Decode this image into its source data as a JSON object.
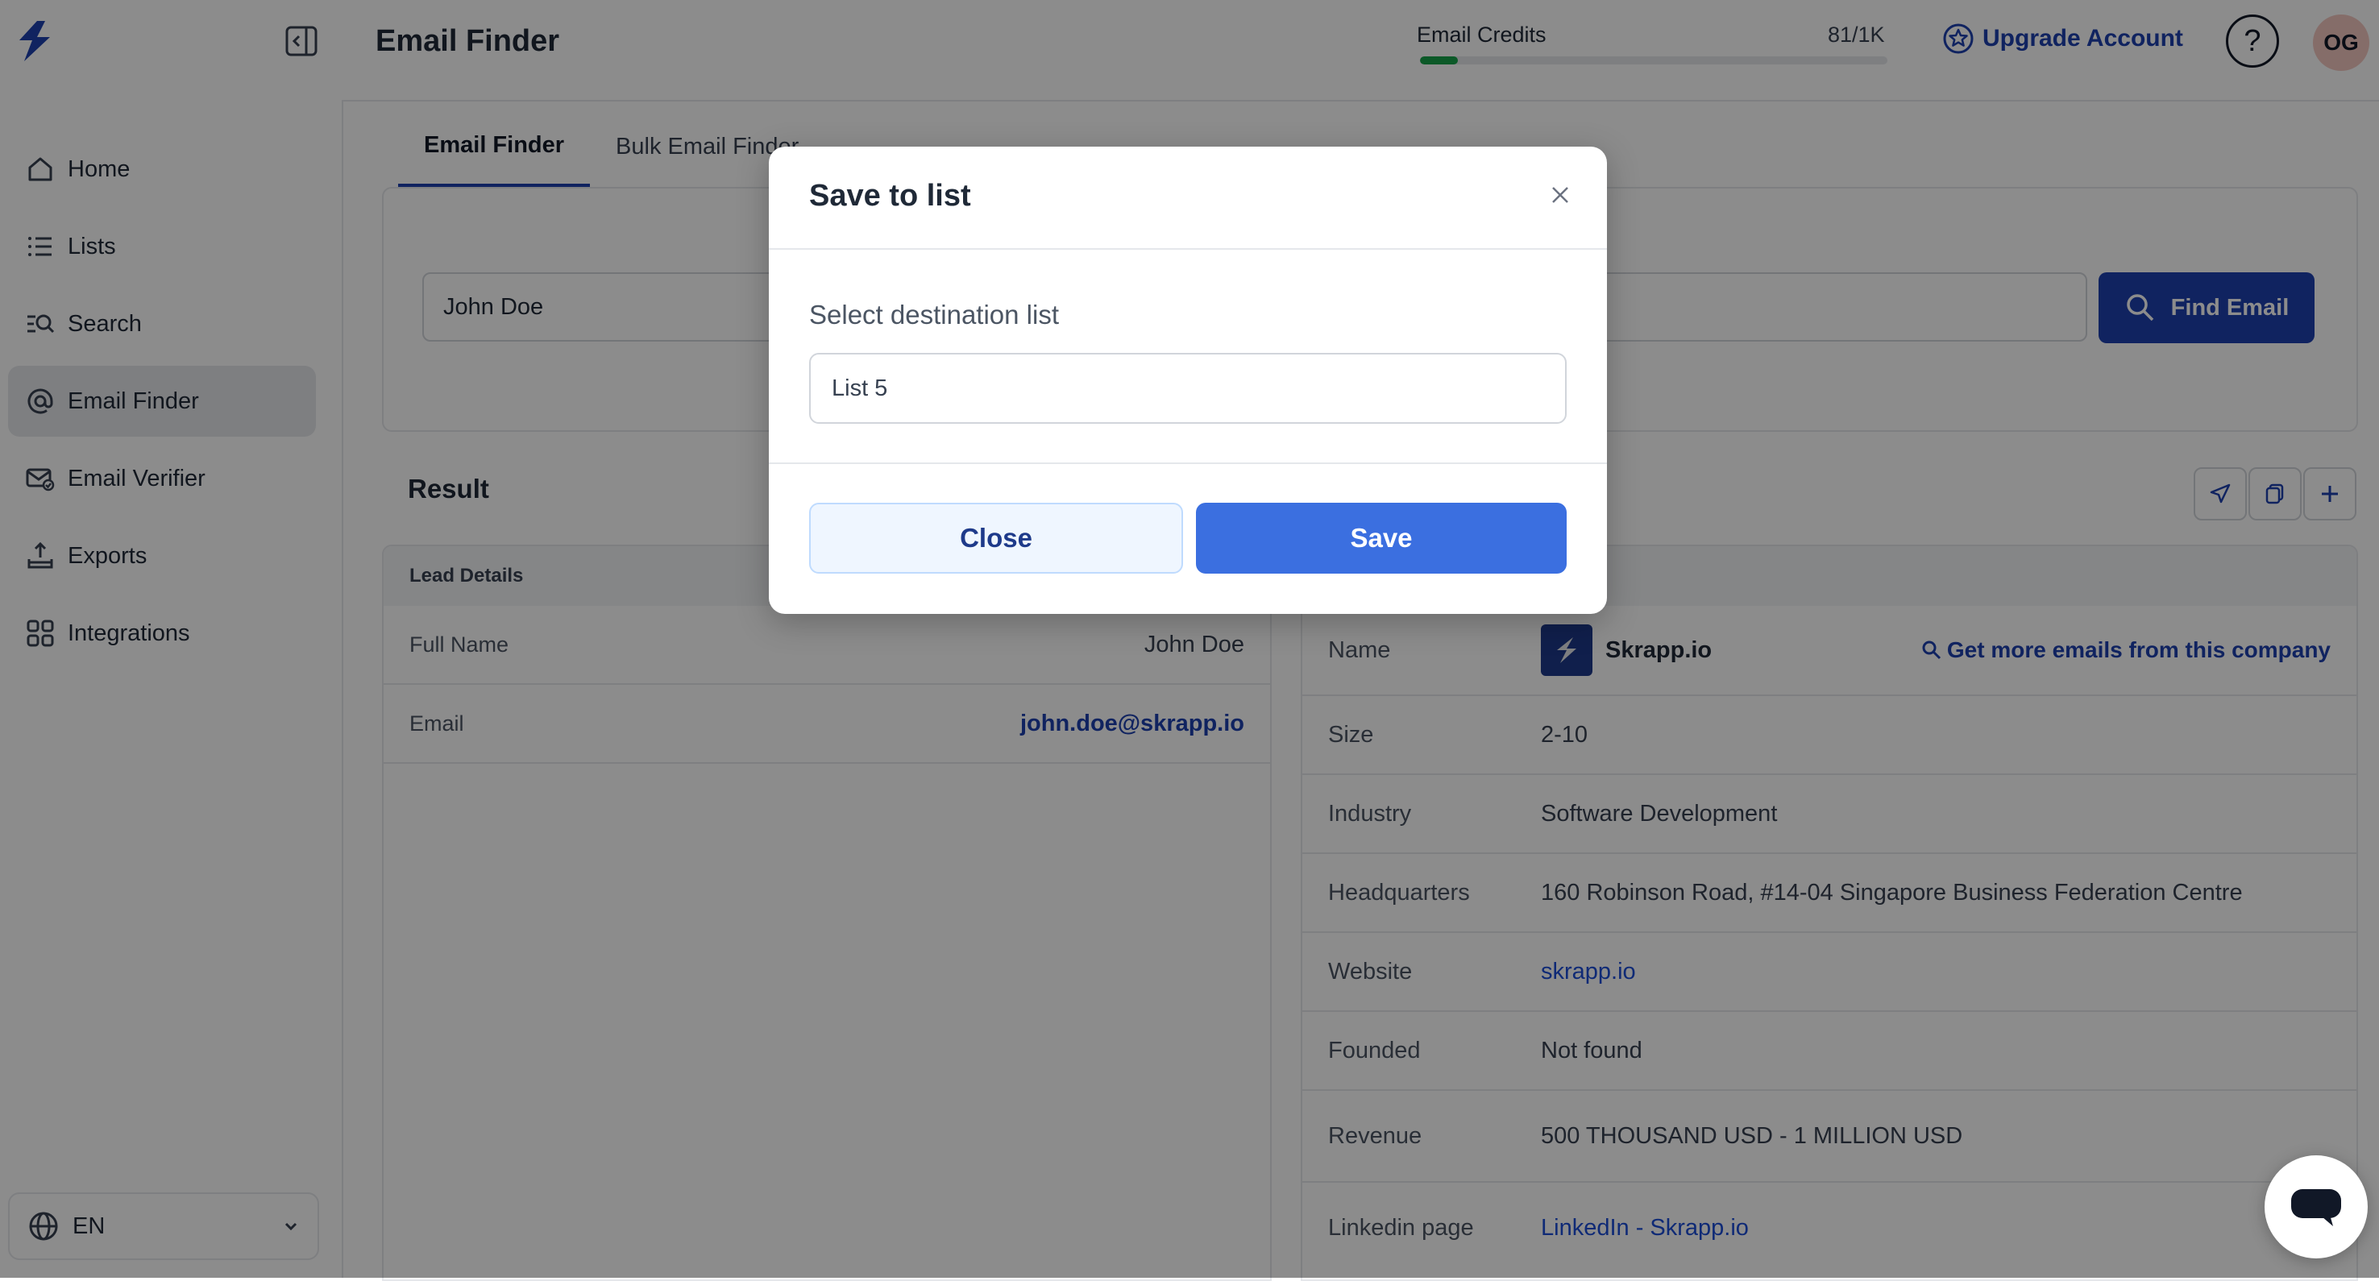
{
  "app": {
    "page_title": "Email Finder"
  },
  "sidebar": {
    "items": [
      {
        "label": "Home",
        "icon": "home-icon"
      },
      {
        "label": "Lists",
        "icon": "list-icon"
      },
      {
        "label": "Search",
        "icon": "search-list-icon"
      },
      {
        "label": "Email Finder",
        "icon": "at-sign-icon",
        "active": true
      },
      {
        "label": "Email Verifier",
        "icon": "mail-check-icon"
      },
      {
        "label": "Exports",
        "icon": "export-icon"
      },
      {
        "label": "Integrations",
        "icon": "integrations-icon"
      }
    ],
    "language": "EN"
  },
  "header": {
    "credits_label": "Email Credits",
    "credits_count": "81/1K",
    "credits_used_fraction": 0.081,
    "upgrade_label": "Upgrade Account",
    "help_label": "?",
    "avatar_initials": "OG"
  },
  "tabs": [
    {
      "label": "Email Finder",
      "active": true
    },
    {
      "label": "Bulk Email Finder",
      "active": false
    }
  ],
  "search": {
    "name_value": "John Doe",
    "find_button": "Find Email"
  },
  "result": {
    "title": "Result",
    "lead_header": "Lead Details",
    "lead_rows": [
      {
        "key": "Full Name",
        "value": "John Doe"
      },
      {
        "key": "Email",
        "value": "john.doe@skrapp.io"
      }
    ],
    "company_rows": {
      "name_key": "Name",
      "name_value": "Skrapp.io",
      "more_emails": "Get more emails from this company",
      "size_key": "Size",
      "size_value": "2-10",
      "industry_key": "Industry",
      "industry_value": "Software Development",
      "hq_key": "Headquarters",
      "hq_value": "160 Robinson Road, #14-04 Singapore Business Federation Centre",
      "website_key": "Website",
      "website_value": "skrapp.io",
      "founded_key": "Founded",
      "founded_value": "Not found",
      "revenue_key": "Revenue",
      "revenue_value": "500 THOUSAND USD - 1 MILLION USD",
      "linkedin_key": "Linkedin page",
      "linkedin_value": "LinkedIn - Skrapp.io"
    }
  },
  "modal": {
    "title": "Save to list",
    "field_label": "Select destination list",
    "selected_list": "List 5",
    "close_button": "Close",
    "save_button": "Save"
  },
  "colors": {
    "brand": "#1e40af",
    "save_button": "#3b6fe0",
    "credits_bar": "#16a34a"
  }
}
